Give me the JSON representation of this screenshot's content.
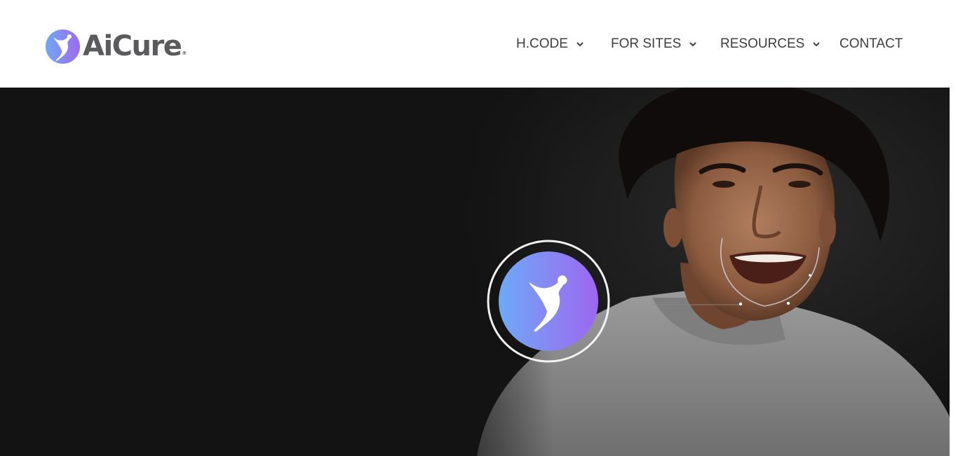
{
  "brand": {
    "name": "AiCure",
    "registered_mark": "®",
    "logo_gradient": [
      "#6ea8f7",
      "#9a6df0"
    ]
  },
  "nav": {
    "items": [
      {
        "label": "H.CODE",
        "has_dropdown": true
      },
      {
        "label": "FOR SITES",
        "has_dropdown": true
      },
      {
        "label": "RESOURCES",
        "has_dropdown": true
      },
      {
        "label": "CONTACT",
        "has_dropdown": false
      }
    ]
  },
  "hero": {
    "background": "#131313",
    "badge_icon": "aicure-figure-icon",
    "photo": "smiling-man-in-grey-sweater"
  }
}
